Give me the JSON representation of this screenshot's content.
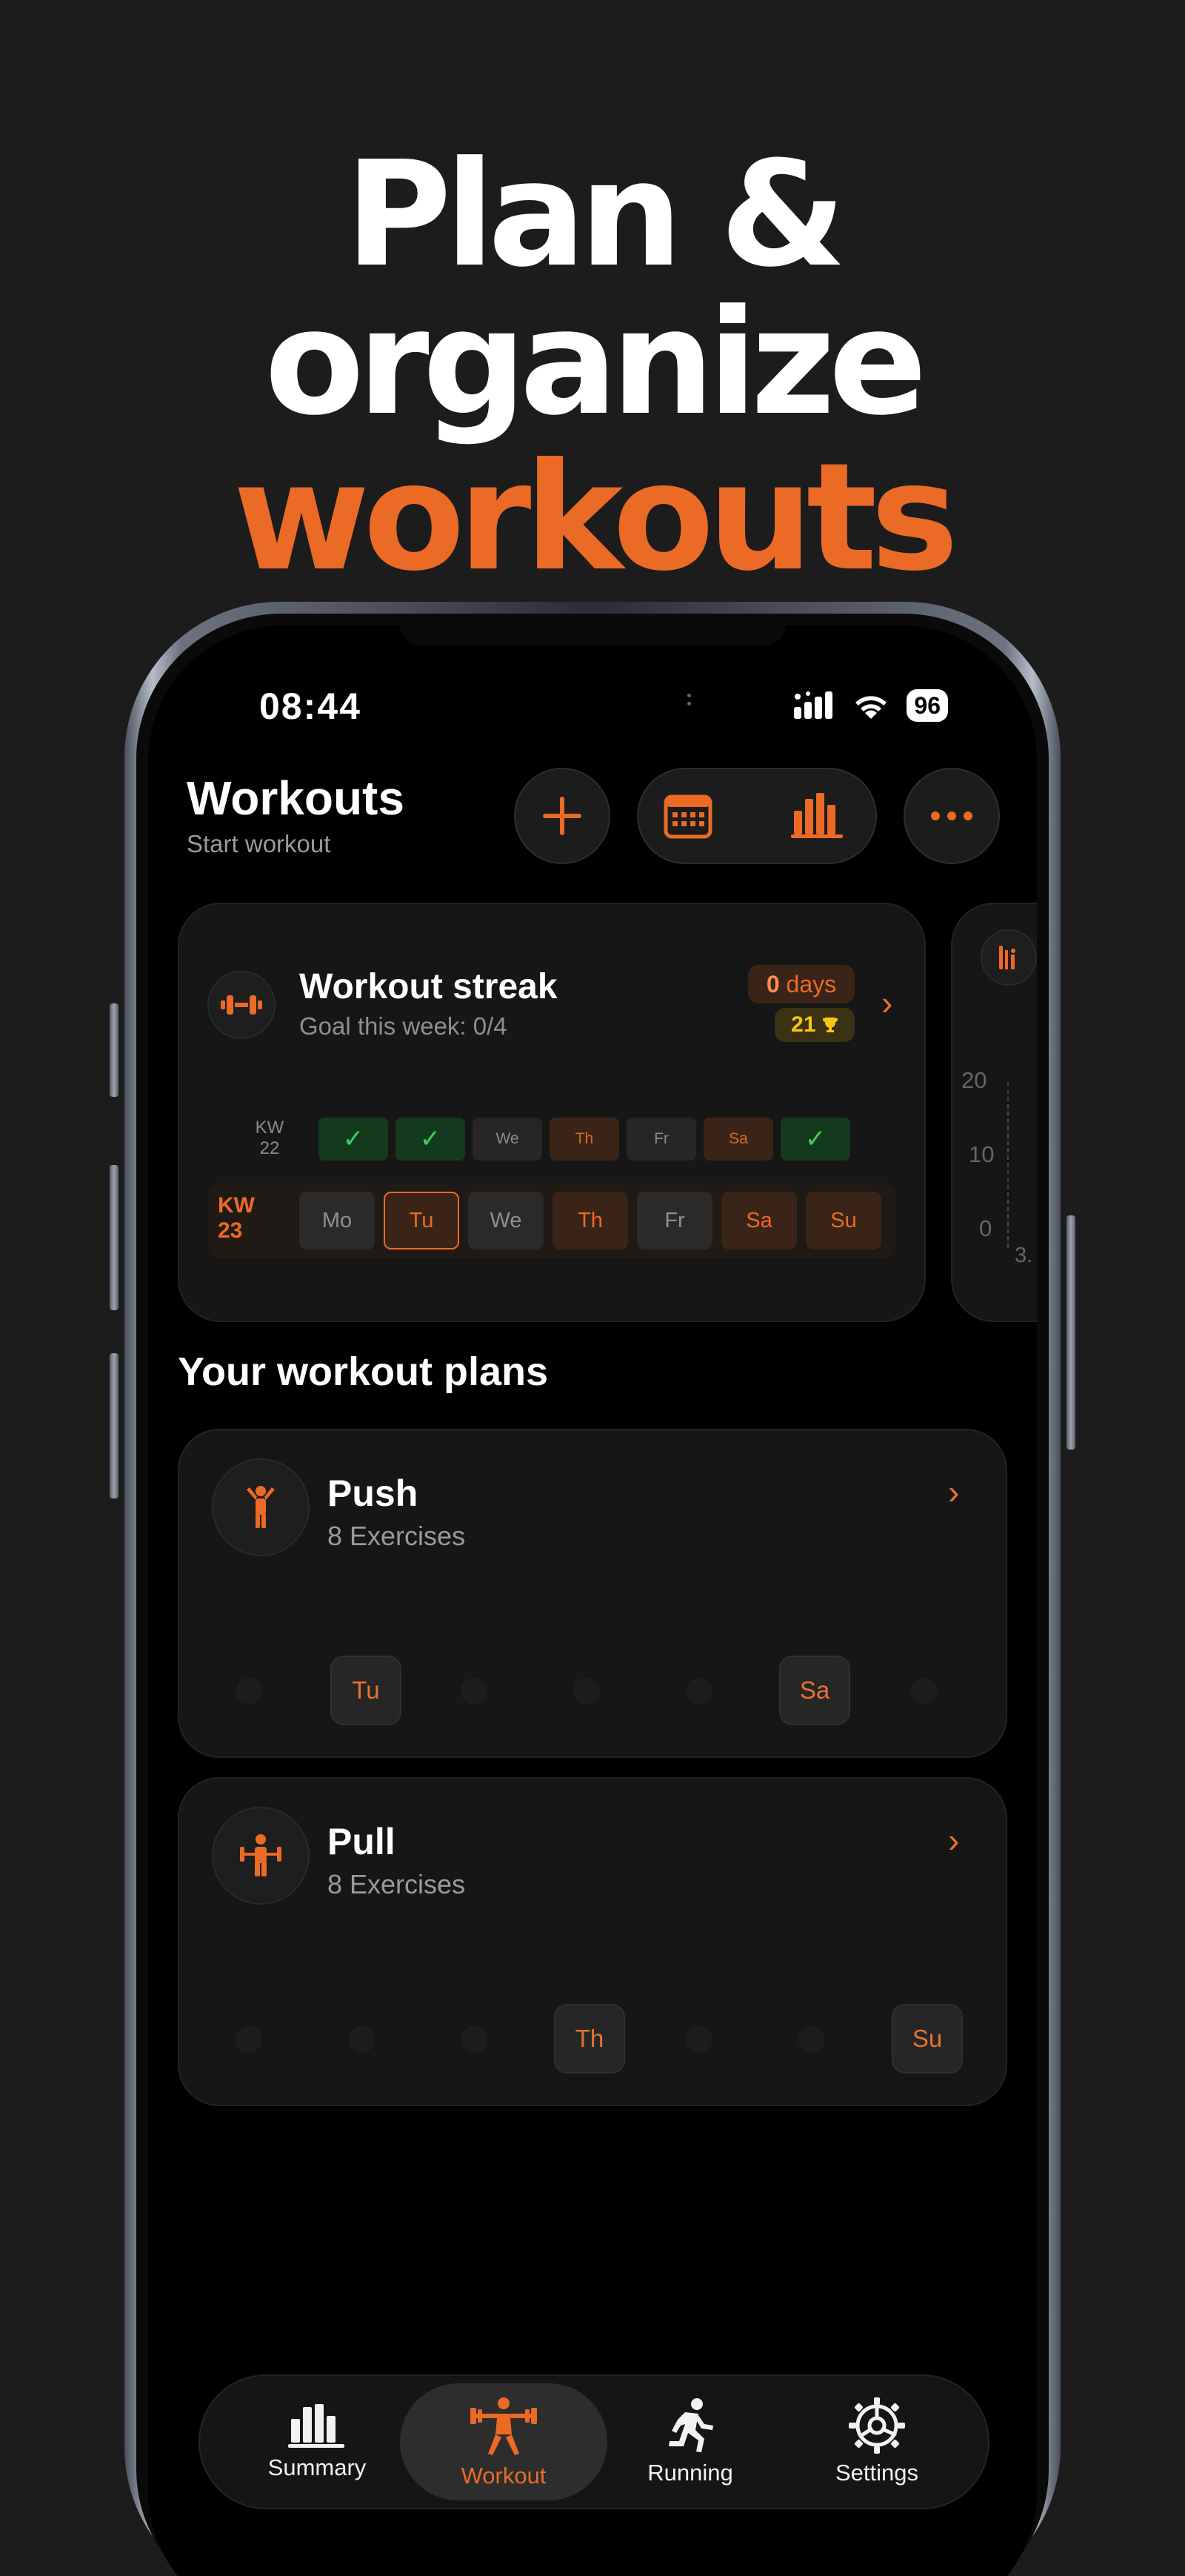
{
  "headline": {
    "line1": "Plan & organize",
    "line2": "workouts"
  },
  "status_bar": {
    "time": "08:44",
    "battery": "96"
  },
  "header": {
    "title": "Workouts",
    "subtitle": "Start workout"
  },
  "streak_card": {
    "title": "Workout streak",
    "goal": "Goal this week: 0/4",
    "days_count": "0",
    "days_unit": "days",
    "best": "21",
    "prev_week": {
      "label_top": "KW",
      "label_bottom": "22",
      "days": [
        "✓",
        "✓",
        "We",
        "Th",
        "Fr",
        "Sa",
        "✓"
      ]
    },
    "current_week": {
      "label_top": "KW",
      "label_bottom": "23",
      "days": [
        "Mo",
        "Tu",
        "We",
        "Th",
        "Fr",
        "Sa",
        "Su"
      ]
    }
  },
  "peek_card": {
    "ticks": [
      "20",
      "10",
      "0"
    ],
    "tail": "3."
  },
  "plans_section": {
    "title": "Your workout plans"
  },
  "plans": [
    {
      "name": "Push",
      "exercises": "8 Exercises",
      "days": [
        "Tu",
        "Sa"
      ]
    },
    {
      "name": "Pull",
      "exercises": "8 Exercises",
      "days": [
        "Th",
        "Su"
      ]
    }
  ],
  "tabs": [
    {
      "label": "Summary",
      "icon": "bar-chart-icon"
    },
    {
      "label": "Workout",
      "icon": "weightlifter-icon"
    },
    {
      "label": "Running",
      "icon": "runner-icon"
    },
    {
      "label": "Settings",
      "icon": "gear-icon"
    }
  ],
  "colors": {
    "accent": "#ea6a26",
    "success": "#3ccf5b",
    "gold": "#f5c518",
    "background": "#000000"
  }
}
